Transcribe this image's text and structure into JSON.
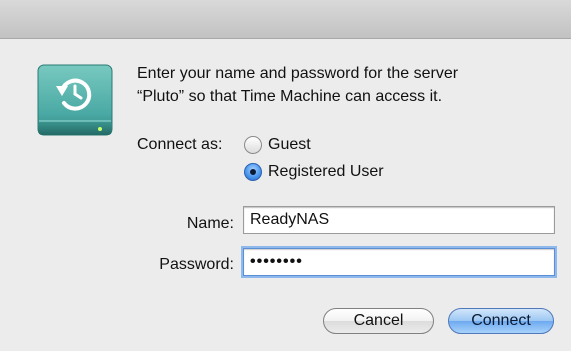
{
  "dialog": {
    "icon": "time-machine-drive-icon",
    "message_lines": [
      "Enter your name and password for the server",
      "“Pluto” so that Time Machine can access it."
    ],
    "connect_as_label": "Connect as:",
    "options": [
      {
        "label": "Guest",
        "selected": false
      },
      {
        "label": "Registered User",
        "selected": true
      }
    ],
    "name_label": "Name:",
    "name_value": "ReadyNAS",
    "password_label": "Password:",
    "password_value": "••••••••",
    "cancel_label": "Cancel",
    "connect_label": "Connect"
  },
  "colors": {
    "window_bg": "#ececec",
    "icon_teal": "#4aa9a4",
    "default_button": "#8fc0f2"
  }
}
